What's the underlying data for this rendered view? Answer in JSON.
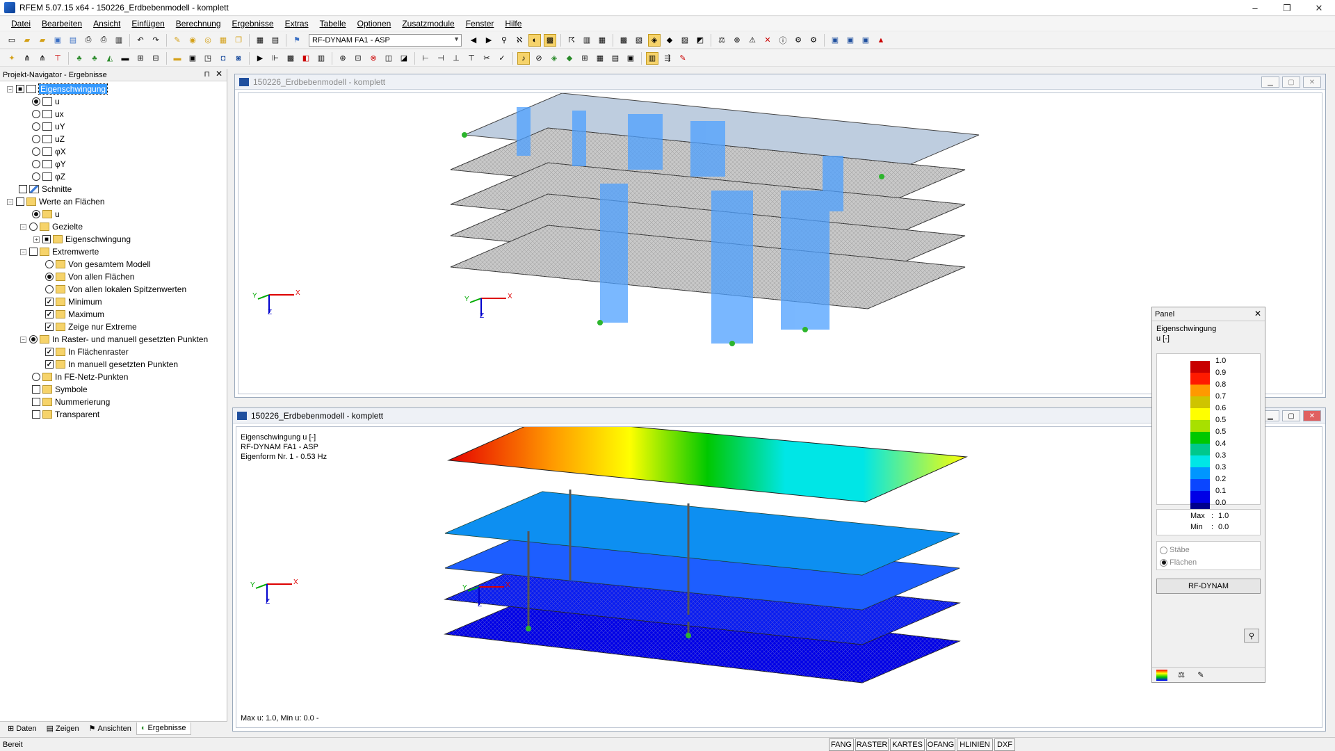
{
  "app": {
    "title": "RFEM 5.07.15 x64 - 150226_Erdbebenmodell - komplett",
    "minimize": "–",
    "maximize": "❐",
    "close": "✕"
  },
  "menu": [
    "Datei",
    "Bearbeiten",
    "Ansicht",
    "Einfügen",
    "Berechnung",
    "Ergebnisse",
    "Extras",
    "Tabelle",
    "Optionen",
    "Zusatzmodule",
    "Fenster",
    "Hilfe"
  ],
  "toolbar": {
    "loadcase": "RF-DYNAM FA1 - ASP"
  },
  "navigator": {
    "title": "Projekt-Navigator - Ergebnisse",
    "pin": "⊓",
    "close": "✕",
    "items": [
      {
        "label": "Eigenschwingung"
      },
      {
        "label": "u"
      },
      {
        "label": "ux"
      },
      {
        "label": "uY"
      },
      {
        "label": "uZ"
      },
      {
        "label": "φX"
      },
      {
        "label": "φY"
      },
      {
        "label": "φZ"
      },
      {
        "label": "Schnitte"
      },
      {
        "label": "Werte an Flächen"
      },
      {
        "label": "u"
      },
      {
        "label": "Gezielte"
      },
      {
        "label": "Eigenschwingung"
      },
      {
        "label": "Extremwerte"
      },
      {
        "label": "Von gesamtem Modell"
      },
      {
        "label": "Von allen Flächen"
      },
      {
        "label": "Von allen lokalen Spitzenwerten"
      },
      {
        "label": "Minimum"
      },
      {
        "label": "Maximum"
      },
      {
        "label": "Zeige nur Extreme"
      },
      {
        "label": "In Raster- und manuell gesetzten Punkten"
      },
      {
        "label": "In Flächenraster"
      },
      {
        "label": "In manuell gesetzten Punkten"
      },
      {
        "label": "In FE-Netz-Punkten"
      },
      {
        "label": "Symbole"
      },
      {
        "label": "Nummerierung"
      },
      {
        "label": "Transparent"
      }
    ],
    "tabs": [
      "Daten",
      "Zeigen",
      "Ansichten",
      "Ergebnisse"
    ]
  },
  "window1": {
    "title": "150226_Erdbebenmodell - komplett",
    "axes": {
      "x": "X",
      "y": "Y",
      "z": "Z"
    }
  },
  "window2": {
    "title": "150226_Erdbebenmodell - komplett",
    "info": [
      "Eigenschwingung  u [-]",
      "RF-DYNAM FA1 - ASP",
      "Eigenform Nr. 1 - 0.53 Hz"
    ],
    "footer": "Max u: 1.0, Min u: 0.0 -",
    "axes": {
      "x": "X",
      "y": "Y",
      "z": "Z"
    }
  },
  "panel": {
    "title": "Panel",
    "close": "✕",
    "heading": "Eigenschwingung",
    "unit": "u [-]",
    "legend": [
      {
        "value": "1.0",
        "color": "#c80000"
      },
      {
        "value": "0.9",
        "color": "#ff1a00"
      },
      {
        "value": "0.8",
        "color": "#ff9900"
      },
      {
        "value": "0.7",
        "color": "#cfc400"
      },
      {
        "value": "0.6",
        "color": "#ffff00"
      },
      {
        "value": "0.5",
        "color": "#a8e000"
      },
      {
        "value": "0.5",
        "color": "#00c800"
      },
      {
        "value": "0.4",
        "color": "#00c88c"
      },
      {
        "value": "0.3",
        "color": "#00e6e6"
      },
      {
        "value": "0.3",
        "color": "#0096ff"
      },
      {
        "value": "0.2",
        "color": "#0a46ff"
      },
      {
        "value": "0.1",
        "color": "#0000e6"
      },
      {
        "value": "0.0",
        "color": "#00008c"
      }
    ],
    "max_label": "Max",
    "max_value": "1.0",
    "min_label": "Min",
    "min_value": "0.0",
    "colon": ":",
    "option_staebe": "Stäbe",
    "option_flaechen": "Flächen",
    "button": "RF-DYNAM"
  },
  "status": {
    "ready": "Bereit",
    "toggles": [
      "FANG",
      "RASTER",
      "KARTES",
      "OFANG",
      "HLINIEN",
      "DXF"
    ]
  }
}
